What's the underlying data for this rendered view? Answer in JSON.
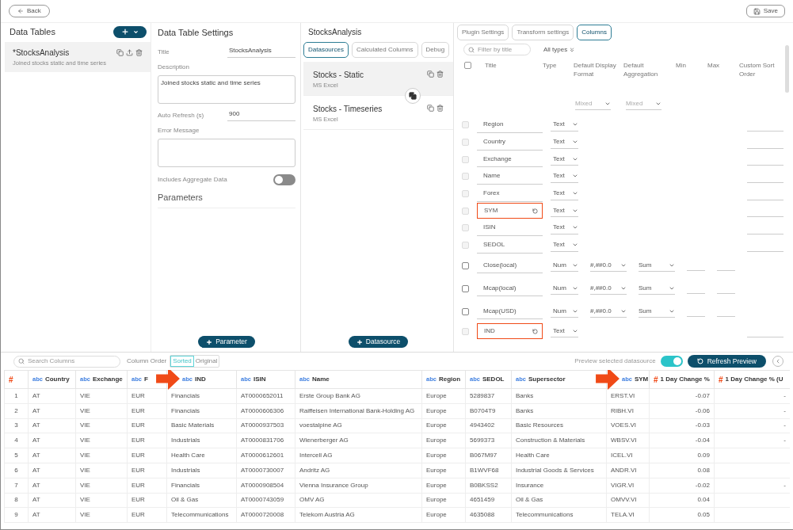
{
  "top_bar": {
    "back": "Back",
    "save": "Save"
  },
  "data_tables": {
    "title": "Data Tables",
    "items": [
      {
        "name": "*StocksAnalysis",
        "description": "Joined stocks static and time series",
        "selected": true
      }
    ]
  },
  "settings": {
    "title": "Data Table Settings",
    "fields": [
      {
        "kind": "line",
        "label": "Title",
        "value": "StocksAnalysis"
      },
      {
        "kind": "area",
        "label": "Description",
        "value": "Joined stocks  static and time series"
      },
      {
        "kind": "line",
        "label": "Auto Refresh (s)",
        "value": "900"
      },
      {
        "kind": "area",
        "label": "Error Message"
      }
    ],
    "aggregate": {
      "label": "Includes Aggregate Data",
      "on": false
    },
    "parameters_title": "Parameters",
    "add_parameter": "Parameter"
  },
  "datasources_panel": {
    "title": "StocksAnalysis",
    "tabs": [
      {
        "label": "Datasources",
        "selected": true
      },
      {
        "label": "Calculated Columns",
        "selected": false
      },
      {
        "label": "Debug",
        "selected": false
      }
    ],
    "items": [
      {
        "name": "Stocks - Static",
        "source": "MS Excel",
        "selected": true
      },
      {
        "name": "Stocks - Timeseries",
        "source": "MS Excel",
        "selected": false
      }
    ],
    "add_datasource": "Datasource"
  },
  "columns_panel": {
    "tabs": [
      {
        "label": "Plugin Settings",
        "selected": false
      },
      {
        "label": "Transform settings",
        "selected": false
      },
      {
        "label": "Columns",
        "selected": true
      }
    ],
    "filter_placeholder": "Filter by title",
    "types_filter": "All types",
    "headers": [
      "Title",
      "Type",
      "Default Display Format",
      "Default Aggregation",
      "Min",
      "Max",
      "Custom Sort Order"
    ],
    "mixed": [
      "Mixed",
      "Mixed"
    ],
    "select_all_checked": false,
    "rows": [
      {
        "kind": "text",
        "title": "Region",
        "type": "Text",
        "disabled": true,
        "highlighted": false
      },
      {
        "kind": "text",
        "title": "Country",
        "type": "Text",
        "disabled": true,
        "highlighted": false
      },
      {
        "kind": "text",
        "title": "Exchange",
        "type": "Text",
        "disabled": true,
        "highlighted": false
      },
      {
        "kind": "text",
        "title": "Name",
        "type": "Text",
        "disabled": true,
        "highlighted": false
      },
      {
        "kind": "text",
        "title": "Forex",
        "type": "Text",
        "disabled": true,
        "highlighted": false
      },
      {
        "kind": "text",
        "title": "SYM",
        "type": "Text",
        "disabled": true,
        "highlighted": true
      },
      {
        "kind": "text",
        "title": "ISIN",
        "type": "Text",
        "disabled": true,
        "highlighted": false
      },
      {
        "kind": "text",
        "title": "SEDOL",
        "type": "Text",
        "disabled": true,
        "highlighted": false
      },
      {
        "kind": "number",
        "title": "Close(local)",
        "type": "Num",
        "format": "#,##0.0",
        "aggregation": "Sum",
        "disabled": false,
        "highlighted": false
      },
      {
        "kind": "number",
        "title": "Mcap(local)",
        "type": "Num",
        "format": "#,##0.0",
        "aggregation": "Sum",
        "disabled": false,
        "highlighted": false
      },
      {
        "kind": "number",
        "title": "Mcap(USD)",
        "type": "Num",
        "format": "#,##0.0",
        "aggregation": "Sum",
        "disabled": false,
        "highlighted": false
      },
      {
        "kind": "text",
        "title": "IND",
        "type": "Text",
        "disabled": true,
        "highlighted": true
      }
    ]
  },
  "preview": {
    "search_placeholder": "Search Columns",
    "column_order_label": "Column Order",
    "order_options": [
      {
        "label": "Sorted",
        "selected": true
      },
      {
        "label": "Original",
        "selected": false
      }
    ],
    "preview_label": "Preview selected datasource",
    "preview_on": true,
    "refresh": "Refresh Preview",
    "table": {
      "columns": [
        {
          "title": "#",
          "kind": "index",
          "arrow": false
        },
        {
          "title": "Country",
          "type": "abc",
          "arrow": false
        },
        {
          "title": "Exchange",
          "type": "abc",
          "arrow": false
        },
        {
          "title": "F",
          "type": "abc",
          "arrow": false
        },
        {
          "title": "IND",
          "type": "abc",
          "arrow": true
        },
        {
          "title": "ISIN",
          "type": "abc",
          "arrow": false
        },
        {
          "title": "Name",
          "type": "abc",
          "arrow": false
        },
        {
          "title": "Region",
          "type": "abc",
          "arrow": false
        },
        {
          "title": "SEDOL",
          "type": "abc",
          "arrow": false
        },
        {
          "title": "Supersector",
          "type": "abc",
          "arrow": false
        },
        {
          "title": "SYM",
          "type": "abc",
          "arrow": true
        },
        {
          "title": "1 Day Change %",
          "type": "#",
          "arrow": false
        },
        {
          "title": "1 Day Change % (U",
          "type": "#",
          "arrow": false
        }
      ],
      "rows": [
        [
          "1",
          "AT",
          "VIE",
          "EUR",
          "Financials",
          "AT0000652011",
          "Erste Group Bank AG",
          "Europe",
          "5289837",
          "Banks",
          "ERST.VI",
          "-0.07",
          "-"
        ],
        [
          "2",
          "AT",
          "VIE",
          "EUR",
          "Financials",
          "AT0000606306",
          "Raiffeisen International Bank-Holding AG",
          "Europe",
          "B0704T9",
          "Banks",
          "RIBH.VI",
          "-0.06",
          "-"
        ],
        [
          "3",
          "AT",
          "VIE",
          "EUR",
          "Basic Materials",
          "AT0000937503",
          "voestalpine AG",
          "Europe",
          "4943402",
          "Basic Resources",
          "VOES.VI",
          "-0.03",
          "-"
        ],
        [
          "4",
          "AT",
          "VIE",
          "EUR",
          "Industrials",
          "AT0000831706",
          "Wienerberger AG",
          "Europe",
          "5699373",
          "Construction & Materials",
          "WBSV.VI",
          "-0.04",
          "-"
        ],
        [
          "5",
          "AT",
          "VIE",
          "EUR",
          "Health Care",
          "AT0000612601",
          "Intercell AG",
          "Europe",
          "B067M97",
          "Health Care",
          "ICEL.VI",
          "0.09"
        ],
        [
          "6",
          "AT",
          "VIE",
          "EUR",
          "Industrials",
          "AT0000730007",
          "Andritz AG",
          "Europe",
          "B1WVF68",
          "Industrial Goods & Services",
          "ANDR.VI",
          "0.08"
        ],
        [
          "7",
          "AT",
          "VIE",
          "EUR",
          "Financials",
          "AT0000908504",
          "Vienna Insurance Group",
          "Europe",
          "B0BKSS2",
          "Insurance",
          "VIGR.VI",
          "-0.02",
          "-"
        ],
        [
          "8",
          "AT",
          "VIE",
          "EUR",
          "Oil & Gas",
          "AT0000743059",
          "OMV AG",
          "Europe",
          "4651459",
          "Oil & Gas",
          "OMVV.VI",
          "0.04"
        ],
        [
          "9",
          "AT",
          "VIE",
          "EUR",
          "Telecommunications",
          "AT0000720008",
          "Telekom Austria AG",
          "Europe",
          "4635088",
          "Telecommunications",
          "TELA.VI",
          "0.05"
        ]
      ]
    }
  }
}
